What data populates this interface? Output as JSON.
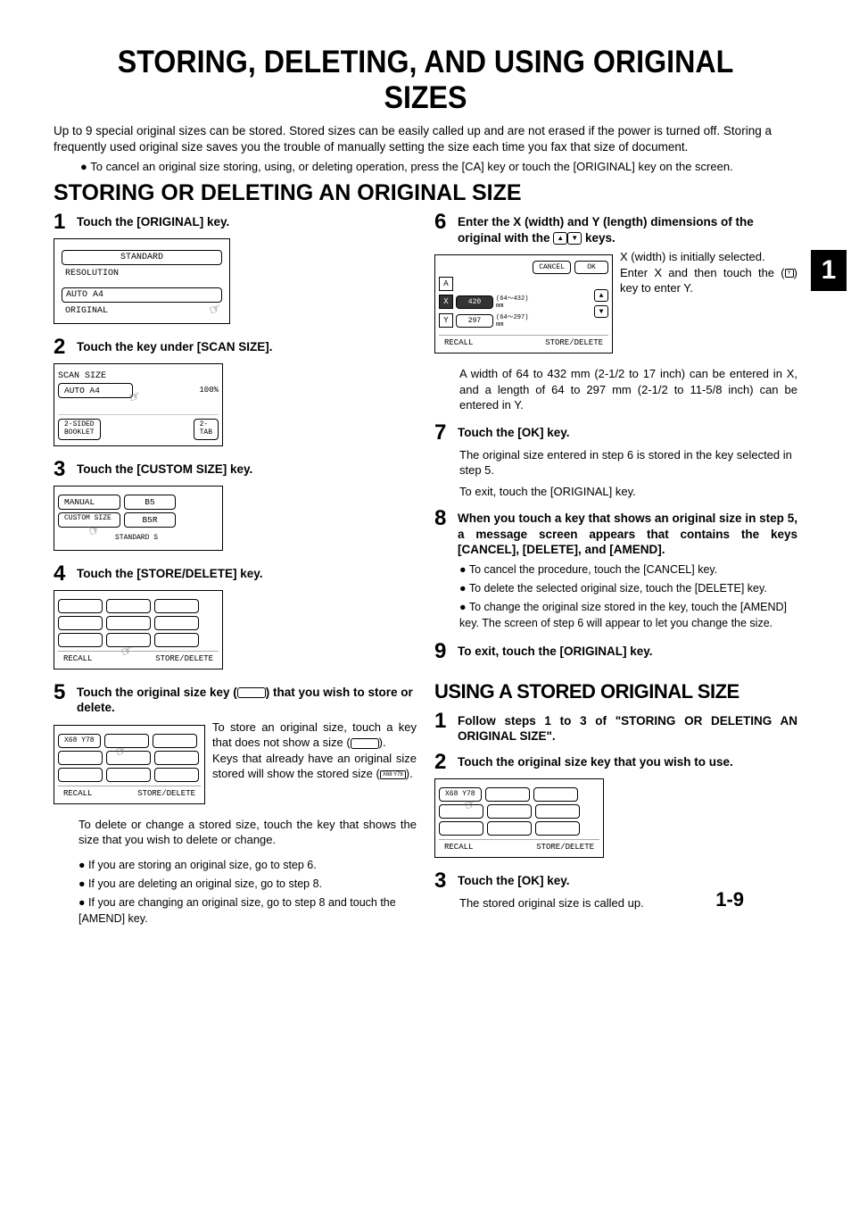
{
  "title": "STORING, DELETING, AND USING ORIGINAL SIZES",
  "intro": "Up to 9 special original sizes can be stored. Stored sizes can be easily called up and are not erased if the power is turned off. Storing a frequently used original size saves you the trouble of manually setting the size each time you fax that size of document.",
  "intro_bullet": "To cancel an original size storing, using, or deleting operation, press the [CA] key or touch the [ORIGINAL] key on the screen.",
  "sectionA_title": "STORING OR DELETING AN ORIGINAL SIZE",
  "tab_number": "1",
  "page_number": "1-9",
  "left": {
    "step1": {
      "num": "1",
      "title": "Touch the [ORIGINAL] key.",
      "screen": {
        "line1": "STANDARD",
        "line2": "RESOLUTION",
        "line3": "AUTO   A4",
        "line4": "ORIGINAL"
      }
    },
    "step2": {
      "num": "2",
      "title": "Touch the key under [SCAN SIZE].",
      "screen": {
        "label": "SCAN SIZE",
        "btn": "AUTO   A4",
        "pct": "100%",
        "side1": "2-SIDED",
        "side2": "BOOKLET",
        "side3": "2-",
        "side4": "TAB"
      }
    },
    "step3": {
      "num": "3",
      "title": "Touch the [CUSTOM SIZE] key.",
      "screen": {
        "b1": "MANUAL",
        "b2": "B5",
        "b3": "CUSTOM SIZE",
        "b4": "B5R",
        "b5": "STANDARD S"
      }
    },
    "step4": {
      "num": "4",
      "title": "Touch the [STORE/DELETE] key.",
      "screen": {
        "recall": "RECALL",
        "storedel": "STORE/DELETE"
      }
    },
    "step5": {
      "num": "5",
      "title_a": "Touch the original size key (",
      "title_b": ") that you wish to store or delete.",
      "screen": {
        "slot": "X68 Y78",
        "recall": "RECALL",
        "storedel": "STORE/DELETE"
      },
      "body1": "To store an original size, touch a key that does not show a size (",
      "body1b": ").",
      "body2a": "Keys that already have an original size stored will show the stored size (",
      "body2_inline": "X68 Y78",
      "body2b": ").",
      "body3": "To delete or change a stored size, touch the key that shows the size that you wish to delete or change.",
      "bul1": "If you are storing an original size, go to step 6.",
      "bul2": "If you are deleting an original size, go to step 8.",
      "bul3": "If you are changing an original size, go to step 8 and touch the [AMEND] key."
    }
  },
  "right": {
    "step6": {
      "num": "6",
      "title_a": "Enter the X (width) and Y (length) dimensions of the original with the ",
      "title_b": " keys.",
      "screen": {
        "cancel": "CANCEL",
        "ok": "OK",
        "A": "A",
        "X": "X",
        "Y": "Y",
        "xval": "420",
        "yval": "297",
        "xrange": "(64～432)",
        "yrange": "(64～297)",
        "mm": "mm",
        "recall": "RECALL",
        "storedel": "STORE/DELETE"
      },
      "body1": "X (width) is initially selected.",
      "body2a": "Enter X and then touch the (",
      "body2_inline": "Y",
      "body2b": ") key to enter Y.",
      "body3": "A width of 64 to 432 mm (2-1/2 to 17 inch) can be entered in X, and a length of 64 to 297 mm (2-1/2 to 11-5/8 inch) can be entered in Y."
    },
    "step7": {
      "num": "7",
      "title": "Touch the [OK] key.",
      "body1": "The original size entered in step 6 is stored in the key selected in step 5.",
      "body2": "To exit, touch the [ORIGINAL] key."
    },
    "step8": {
      "num": "8",
      "title": "When you touch a key that shows an original size in step 5, a message screen appears that contains the keys [CANCEL], [DELETE], and [AMEND].",
      "bul1": "To cancel the procedure, touch the [CANCEL] key.",
      "bul2": "To delete the selected original size, touch the [DELETE] key.",
      "bul3": "To change the original size stored in the key, touch the [AMEND] key. The screen of step 6 will appear to let you change the size."
    },
    "step9": {
      "num": "9",
      "title": "To exit, touch the [ORIGINAL] key."
    },
    "sectionB_title": "USING A STORED ORIGINAL SIZE",
    "u1": {
      "num": "1",
      "title": "Follow steps 1 to 3 of \"STORING OR DELETING AN ORIGINAL SIZE\"."
    },
    "u2": {
      "num": "2",
      "title": "Touch the original size key that you wish to use.",
      "screen": {
        "slot": "X68 Y78",
        "recall": "RECALL",
        "storedel": "STORE/DELETE"
      }
    },
    "u3": {
      "num": "3",
      "title": "Touch the [OK] key.",
      "body": "The stored original size is called up."
    }
  }
}
